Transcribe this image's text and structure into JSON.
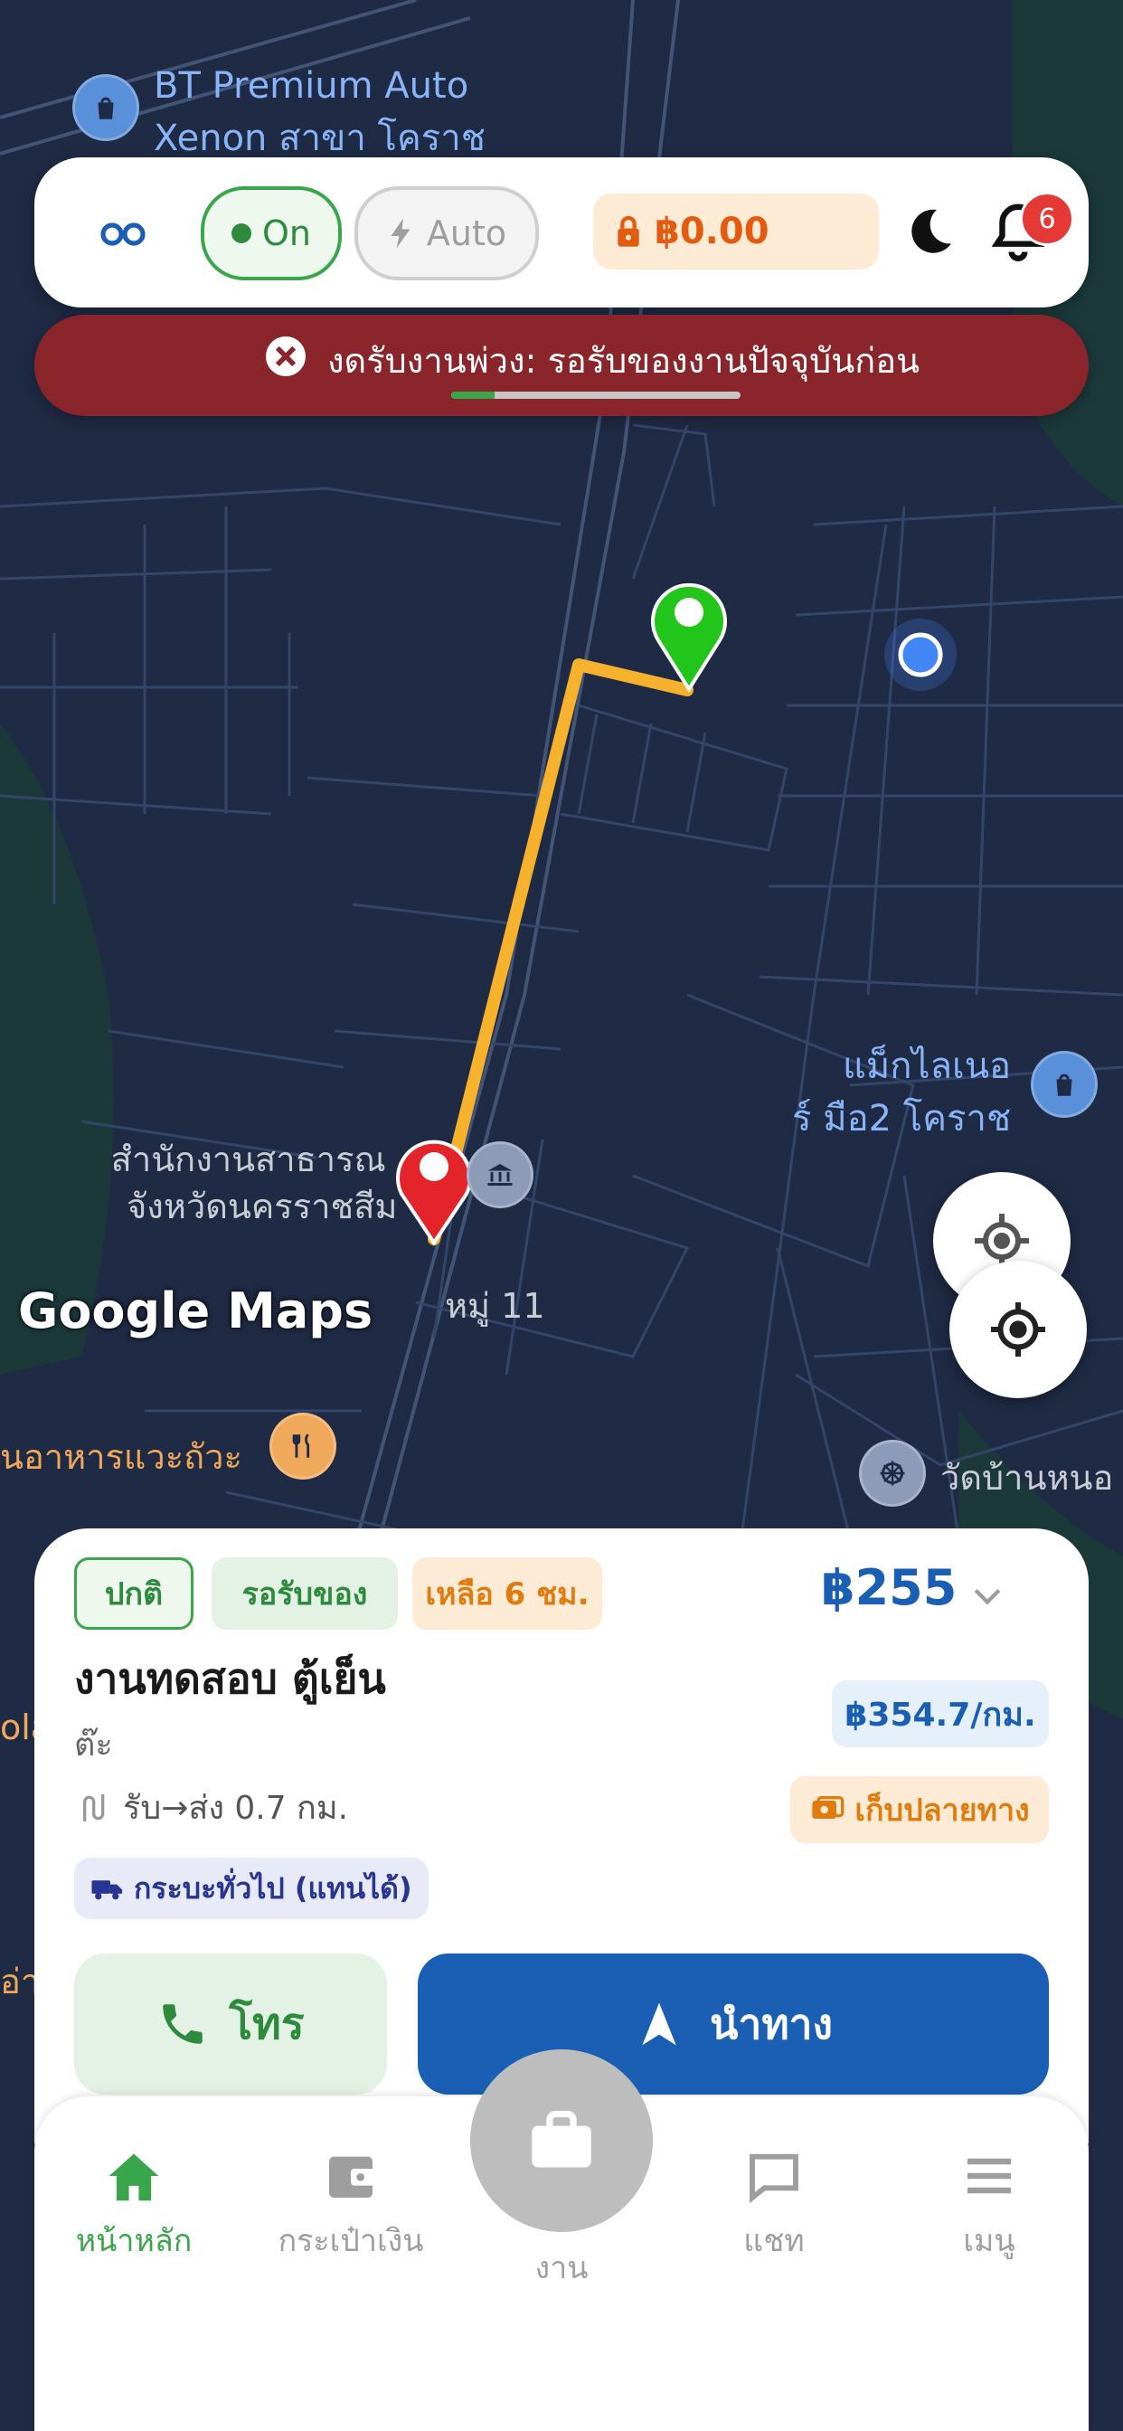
{
  "map": {
    "labels": {
      "bt_premium_line1": "BT Premium Auto",
      "bt_premium_line2": "Xenon สาขา โคราช",
      "max_liner_line1": "แม็กไลเนอ",
      "max_liner_line2": "ร์ มือ2 โคราช",
      "office_line1": "สำนักงานสาธารณ",
      "office_line2": "จังหวัดนครราชสีม",
      "village": "หมู่ 11",
      "restaurant": "นอาหารแวะถัวะ",
      "temple": "วัดบ้านหนอ",
      "edge_left_1": "ola",
      "edge_left_2": "อ่า",
      "attribution": "Google Maps"
    },
    "colors": {
      "route": "#f6b12d",
      "pickup_pin": "#22c51a",
      "dropoff_pin": "#e3242b",
      "current_location": "#4285f4"
    }
  },
  "topbar": {
    "on_label": "On",
    "auto_label": "Auto",
    "wallet_amount": "฿0.00",
    "notification_count": "6"
  },
  "alert": {
    "message": "งดรับงานพ่วง: รอรับของงานปัจจุบันก่อน",
    "progress_fraction": 0.15
  },
  "job": {
    "tag_normal": "ปกติ",
    "tag_waiting": "รอรับของ",
    "tag_time_left": "เหลือ 6 ชม.",
    "price": "฿255",
    "title": "งานทดสอบ ตู้เย็น",
    "customer": "ต๊ะ",
    "distance": "รับ→ส่ง 0.7 กม.",
    "rate": "฿354.7/กม.",
    "cod": "เก็บปลายทาง",
    "vehicle": "กระบะทั่วไป (แทนได้)",
    "call_label": "โทร",
    "navigate_label": "นำทาง"
  },
  "bottom_nav": {
    "home": "หน้าหลัก",
    "wallet": "กระเป๋าเงิน",
    "jobs": "งาน",
    "chat": "แชท",
    "menu": "เมนู"
  }
}
